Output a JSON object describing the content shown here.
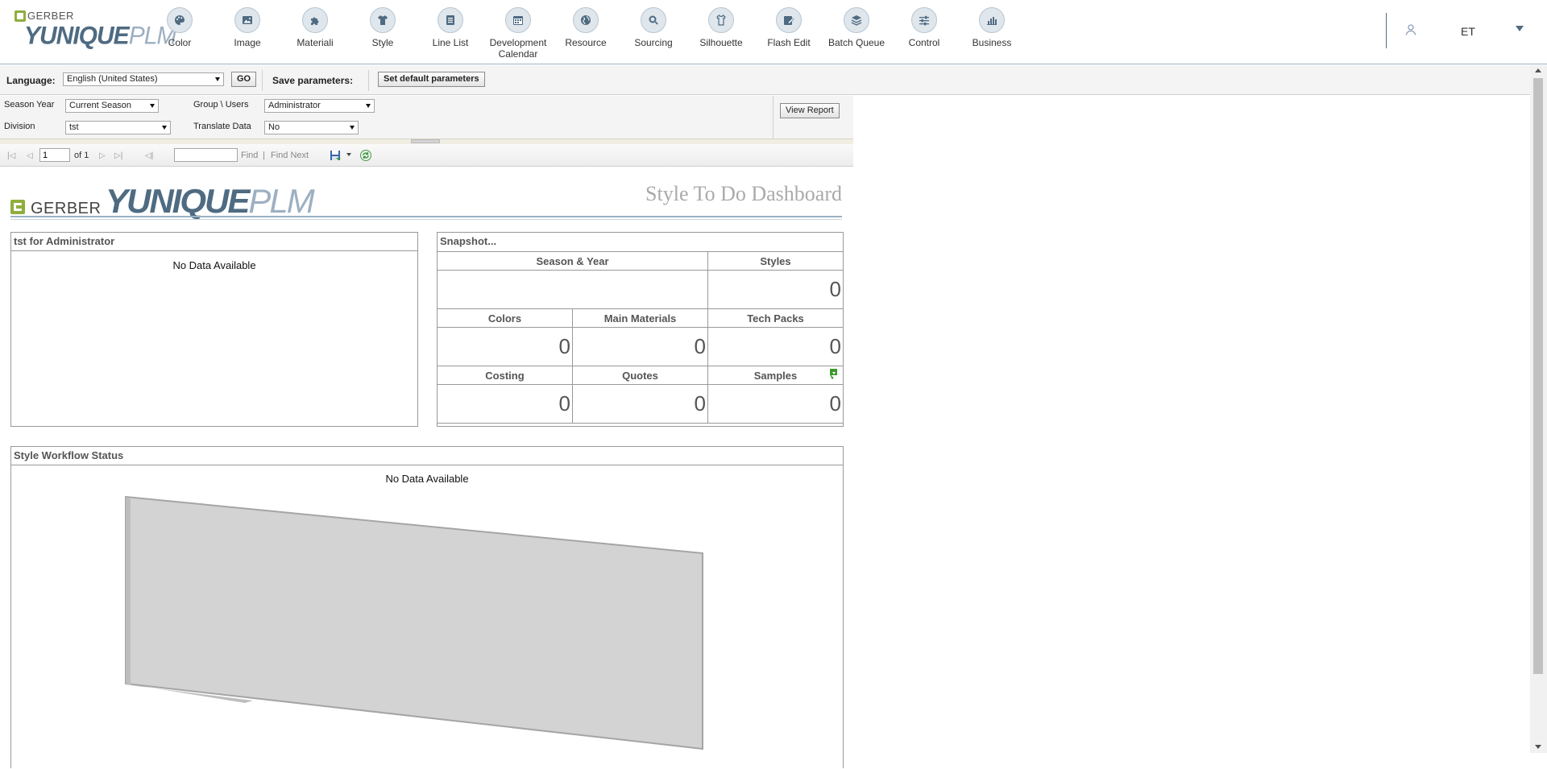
{
  "app": {
    "logo_top": "GERBER",
    "logo_main": "YUNIQUE",
    "logo_suffix": "PLM"
  },
  "nav": {
    "items": [
      {
        "label": "Color",
        "icon": "palette-icon"
      },
      {
        "label": "Image",
        "icon": "image-icon"
      },
      {
        "label": "Materiali",
        "icon": "puzzle-icon"
      },
      {
        "label": "Style",
        "icon": "shirt-icon"
      },
      {
        "label": "Line List",
        "icon": "list-icon"
      },
      {
        "label": "Development Calendar",
        "icon": "calendar-icon"
      },
      {
        "label": "Resource",
        "icon": "globe-icon"
      },
      {
        "label": "Sourcing",
        "icon": "search-globe-icon"
      },
      {
        "label": "Silhouette",
        "icon": "silhouette-icon"
      },
      {
        "label": "Flash Edit",
        "icon": "flash-edit-icon"
      },
      {
        "label": "Batch Queue",
        "icon": "stack-icon"
      },
      {
        "label": "Control",
        "icon": "sliders-icon"
      },
      {
        "label": "Business",
        "icon": "bar-chart-icon"
      }
    ],
    "user_initials": "ET"
  },
  "parambar": {
    "language_label": "Language:",
    "language_value": "English (United States)",
    "go_label": "GO",
    "save_label": "Save parameters:",
    "default_label": "Set default parameters"
  },
  "report_params": {
    "season_year_label": "Season Year",
    "season_year_value": "Current Season",
    "group_users_label": "Group \\ Users",
    "group_users_value": "Administrator",
    "division_label": "Division",
    "division_value": "tst",
    "translate_label": "Translate Data",
    "translate_value": "No",
    "view_report_label": "View Report"
  },
  "viewer": {
    "page_value": "1",
    "of_text": "of 1",
    "find_label": "Find",
    "divider": "|",
    "find_next_label": "Find Next"
  },
  "report": {
    "logo_brand": "GERBER",
    "logo_main": "YUNIQUE",
    "logo_suffix": "PLM",
    "title": "Style To Do Dashboard",
    "todo_panel_title": "tst for Administrator",
    "todo_no_data": "No Data Available",
    "snapshot_title": "Snapshot...",
    "snapshot": {
      "season_year_label": "Season & Year",
      "season_year_value": "",
      "styles_label": "Styles",
      "styles_value": "0",
      "colors_label": "Colors",
      "colors_value": "0",
      "main_materials_label": "Main Materials",
      "main_materials_value": "0",
      "tech_packs_label": "Tech Packs",
      "tech_packs_value": "0",
      "costing_label": "Costing",
      "costing_value": "0",
      "quotes_label": "Quotes",
      "quotes_value": "0",
      "samples_label": "Samples",
      "samples_value": "0"
    },
    "workflow_title": "Style Workflow Status",
    "workflow_no_data": "No Data Available"
  },
  "colors": {
    "brand_blue": "#4e6b82",
    "brand_green": "#8fae3e",
    "panel_border": "#999999"
  }
}
